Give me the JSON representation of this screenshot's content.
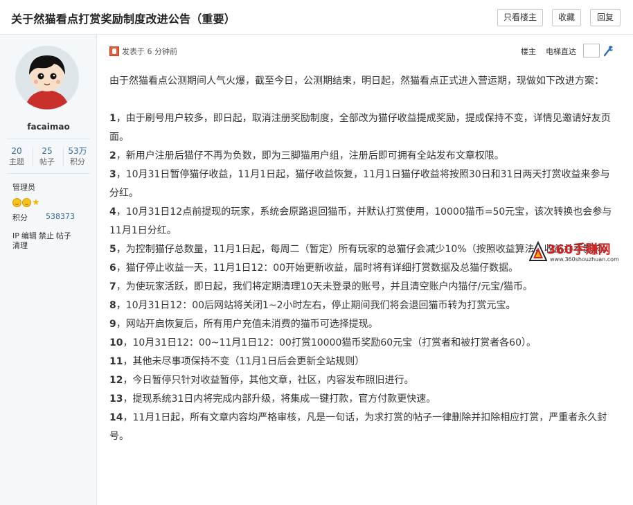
{
  "thread": {
    "title": "关于然猫看点打赏奖励制度改进公告（重要）"
  },
  "actions": {
    "only_author": "只看楼主",
    "favorite": "收藏",
    "reply": "回复"
  },
  "user": {
    "name": "facaimao",
    "stats": [
      {
        "value": "20",
        "label": "主题"
      },
      {
        "value": "25",
        "label": "帖子"
      },
      {
        "value": "53万",
        "label": "积分"
      }
    ],
    "group": "管理员",
    "points_label": "积分",
    "points_value": "538373",
    "admin_links": [
      "IP",
      "编辑",
      "禁止",
      "帖子",
      "清理"
    ]
  },
  "post": {
    "time": "发表于 6 分钟前",
    "floor_label": "楼主",
    "jump_label": "电梯直达",
    "intro": "由于然猫看点公测期间人气火爆，截至今日，公测期结束，明日起，然猫看点正式进入营运期，现做如下改进方案：",
    "items": [
      {
        "num": "1",
        "text": "，由于刷号用户较多，即日起，取消注册奖励制度，全部改为猫仔收益提成奖励，提成保持不变，详情见邀请好友页面。"
      },
      {
        "num": "2",
        "text": "，新用户注册后猫仔不再为负数，即为三脚猫用户组，注册后即可拥有全站发布文章权限。"
      },
      {
        "num": "3",
        "text": "，10月31日暂停猫仔收益，11月1日起，猫仔收益恢复，11月1日猫仔收益将按照30日和31日两天打赏收益来参与分红。"
      },
      {
        "num": "4",
        "text": "，10月31日12点前提现的玩家，系统会原路退回猫币，并默认打赏使用，10000猫币=50元宝，该次转换也会参与11月1日分红。"
      },
      {
        "num": "5",
        "text": "，为控制猫仔总数量，11月1日起，每周二（暂定）所有玩家的总猫仔会减少10%（按照收益算法，收益并不影响）"
      },
      {
        "num": "6",
        "text": "，猫仔停止收益一天，11月1日12：00开始更新收益，届时将有详细打赏数据及总猫仔数据。"
      },
      {
        "num": "7",
        "text": "，为使玩家活跃，即日起，我们将定期清理10天未登录的账号，并且清空账户内猫仔/元宝/猫币。"
      },
      {
        "num": "8",
        "text": "，10月31日12：00后网站将关闭1~2小时左右，停止期间我们将会退回猫币转为打赏元宝。"
      },
      {
        "num": "9",
        "text": "，网站开启恢复后，所有用户充值未消费的猫币可选择提现。"
      },
      {
        "num": "10",
        "text": "，10月31日12：00~11月1日12：00打赏10000猫币奖励60元宝（打赏者和被打赏者各60）。"
      },
      {
        "num": "11",
        "text": "，其他未尽事项保持不变（11月1日后会更新全站规则）"
      },
      {
        "num": "12",
        "text": "，今日暂停只针对收益暂停，其他文章，社区，内容发布照旧进行。"
      },
      {
        "num": "13",
        "text": "，提现系统31日内将完成内部升级，将集成一键打款，官方付款更快速。"
      },
      {
        "num": "14",
        "text": "，11月1日起，所有文章内容均严格审核，凡是一句话，为求打赏的帖子一律删除并扣除相应打赏，严重者永久封号。"
      }
    ]
  },
  "watermark": {
    "brand": "360手赚网",
    "url": "www.360shouzhuan.com"
  },
  "colors": {
    "link": "#336699",
    "watermark_red": "#d2201f",
    "sidebar_bg": "#f5f8fa"
  }
}
